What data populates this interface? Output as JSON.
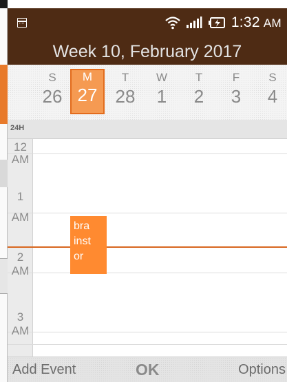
{
  "status_bar": {
    "time": "1:32",
    "ampm": "AM",
    "icons": [
      "calendar-app-icon",
      "wifi-icon",
      "signal-icon",
      "battery-charging-icon"
    ]
  },
  "title": "Week 10, February 2017",
  "days": [
    {
      "name": "S",
      "date": "26",
      "selected": false
    },
    {
      "name": "M",
      "date": "27",
      "selected": true
    },
    {
      "name": "T",
      "date": "28",
      "selected": false
    },
    {
      "name": "W",
      "date": "1",
      "selected": false
    },
    {
      "name": "T",
      "date": "2",
      "selected": false
    },
    {
      "name": "F",
      "date": "3",
      "selected": false
    },
    {
      "name": "S",
      "date": "4",
      "selected": false
    }
  ],
  "allday_label": "24H",
  "hours": [
    {
      "hour": "12",
      "ampm": "AM"
    },
    {
      "hour": "1",
      "ampm": "AM"
    },
    {
      "hour": "2",
      "ampm": "AM"
    },
    {
      "hour": "3",
      "ampm": "AM"
    }
  ],
  "event": {
    "lines": [
      "bra",
      "inst",
      "or"
    ],
    "color": "#ff8a30"
  },
  "softkeys": {
    "left": "Add Event",
    "center": "OK",
    "right": "Options"
  },
  "colors": {
    "header_bg": "#4e2b14",
    "accent": "#e26b1c",
    "selected_day_bg": "#f59a52"
  }
}
